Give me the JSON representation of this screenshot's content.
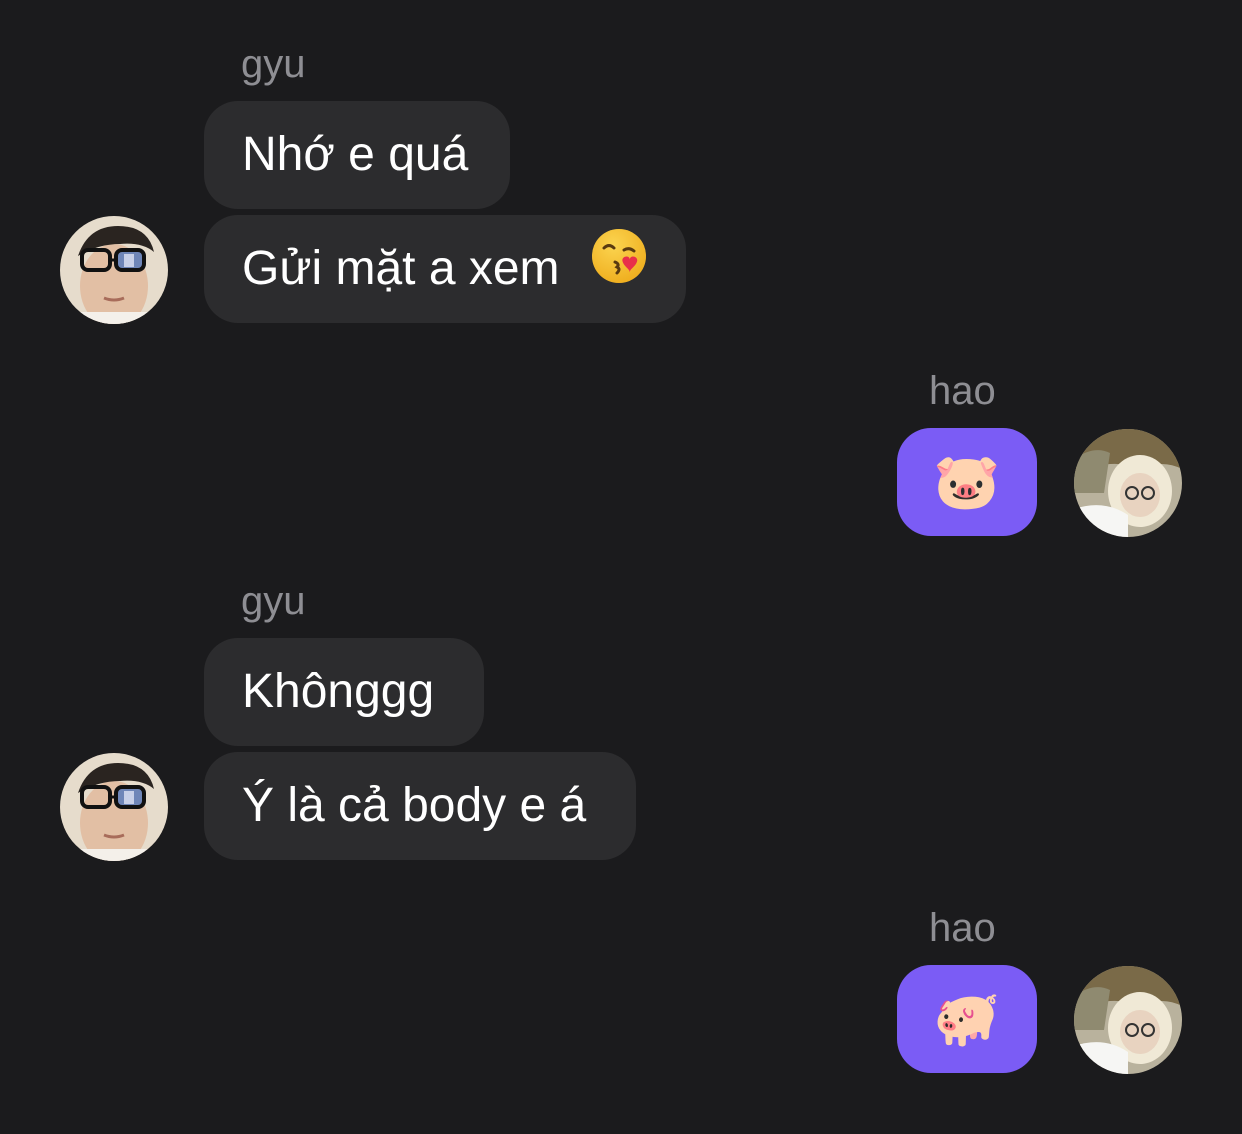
{
  "conversation": {
    "groups": [
      {
        "sender": "gyu",
        "messages": [
          "Nhớ e quá",
          "Gửi mặt a xem"
        ],
        "emoji_name": "kissing-face-emoji"
      },
      {
        "sender": "hao",
        "messages": [
          "🐷"
        ]
      },
      {
        "sender": "gyu",
        "messages": [
          "Khônggg",
          "Ý là cả body e á"
        ]
      },
      {
        "sender": "hao",
        "messages": [
          "🐖"
        ]
      }
    ]
  },
  "colors": {
    "background": "#1b1b1d",
    "incoming_bubble": "#2c2c2e",
    "outgoing_bubble": "#7b5cf5",
    "sender_name": "#8e8e93"
  }
}
